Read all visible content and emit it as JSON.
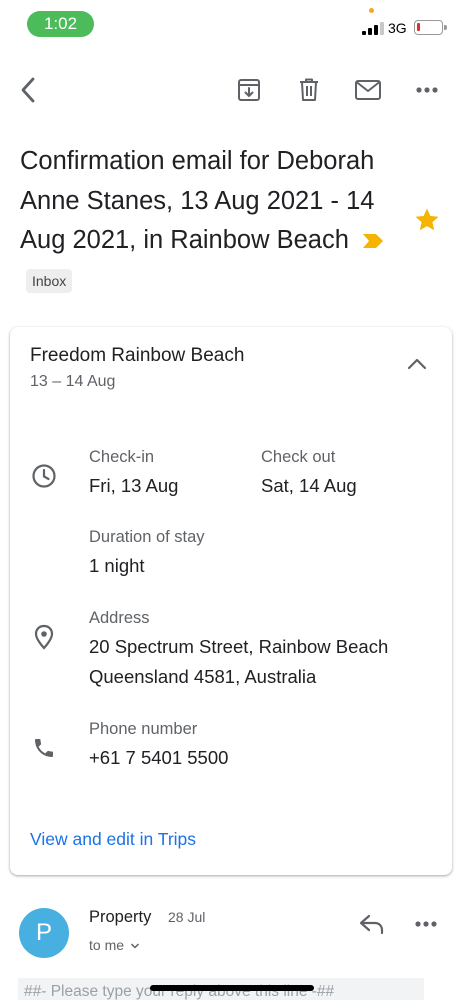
{
  "status_bar": {
    "time": "1:02",
    "network": "3G",
    "signal_bars_active": 3,
    "signal_bars_total": 4,
    "battery_level": 0.15,
    "battery_color": "#e0302a",
    "time_pill_color": "#4cbb5a"
  },
  "toolbar": {
    "back_icon": "chevron-left-icon",
    "archive_icon": "archive-icon",
    "delete_icon": "trash-icon",
    "mark_unread_icon": "mail-icon",
    "more_icon": "more-horiz-icon"
  },
  "email": {
    "subject": "Confirmation email for Deborah Anne Stanes, 13 Aug 2021 - 14 Aug 2021, in Rainbow Beach",
    "label": "Inbox",
    "starred": true,
    "important": true,
    "star_color": "#f4b400",
    "importance_color": "#f4b400"
  },
  "card": {
    "title": "Freedom Rainbow Beach",
    "dates": "13 – 14 Aug",
    "checkin_label": "Check-in",
    "checkin_value": "Fri, 13 Aug",
    "checkout_label": "Check out",
    "checkout_value": "Sat, 14 Aug",
    "duration_label": "Duration of stay",
    "duration_value": "1 night",
    "address_label": "Address",
    "address_line1": "20 Spectrum Street, Rainbow Beach",
    "address_line2": "Queensland 4581, Australia",
    "phone_label": "Phone number",
    "phone_value": "+61 7 5401 5500",
    "link": "View and edit in Trips",
    "link_color": "#1a73e8"
  },
  "message": {
    "avatar_letter": "P",
    "avatar_color": "#47b0e0",
    "sender": "Property",
    "date": "28 Jul",
    "recipient": "to me",
    "snippet": "##- Please type your reply above this line -##"
  }
}
